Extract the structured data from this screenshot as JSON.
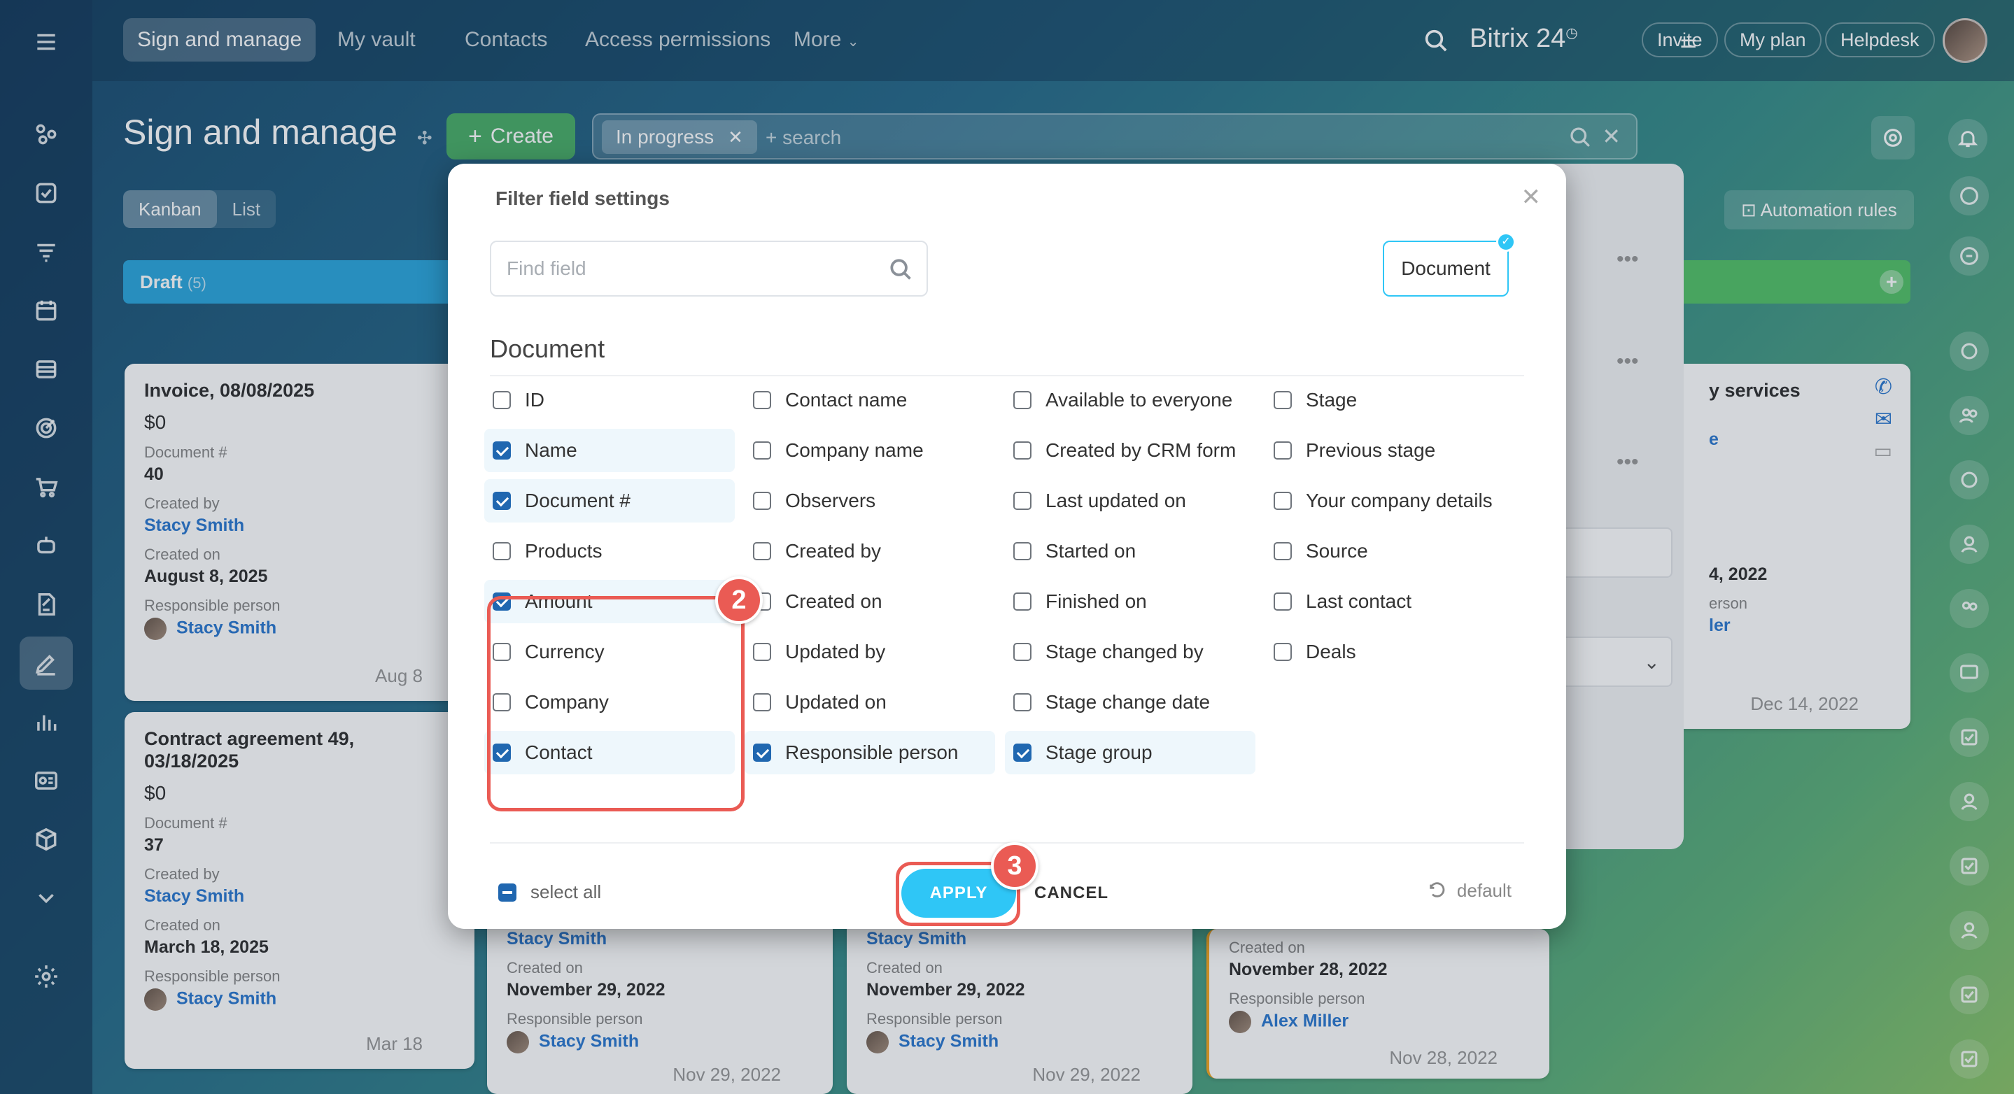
{
  "topbar": {
    "tabs": [
      {
        "label": "Sign and manage"
      },
      {
        "label": "My vault"
      },
      {
        "label": "Contacts"
      },
      {
        "label": "Access permissions"
      },
      {
        "label": "More"
      }
    ],
    "brand": "Bitrix 24",
    "invite_label": "Invite",
    "plan_label": "My plan",
    "helpdesk_label": "Helpdesk"
  },
  "header": {
    "title": "Sign and manage",
    "create_label": "Create",
    "filter_chip": "In progress",
    "search_placeholder": "+ search",
    "views": [
      {
        "label": "Kanban"
      },
      {
        "label": "List"
      }
    ],
    "automation_label": "Automation rules"
  },
  "kanban": {
    "draft_label": "Draft",
    "draft_count": "(5)",
    "cards": [
      {
        "title": "Invoice, 08/08/2025",
        "amount": "$0",
        "doc_label": "Document #",
        "doc_no": "40",
        "created_by_label": "Created by",
        "created_by": "Stacy Smith",
        "created_on_label": "Created on",
        "created_on": "August 8, 2025",
        "resp_label": "Responsible person",
        "resp": "Stacy Smith",
        "date": "Aug 8"
      },
      {
        "title": "Contract agreement 49, 03/18/2025",
        "amount": "$0",
        "doc_label": "Document #",
        "doc_no": "37",
        "created_by_label": "Created by",
        "created_by": "Stacy Smith",
        "created_on_label": "Created on",
        "created_on": "March 18, 2025",
        "resp_label": "Responsible person",
        "resp": "Stacy Smith",
        "date": "Mar 18"
      }
    ],
    "bottom_cards": [
      {
        "created_by": "Stacy Smith",
        "created_on_label": "Created on",
        "created_on": "November 29, 2022",
        "resp_label": "Responsible person",
        "resp": "Stacy Smith",
        "date": "Nov 29, 2022"
      },
      {
        "created_by": "Stacy Smith",
        "created_on_label": "Created on",
        "created_on": "November 29, 2022",
        "resp_label": "Responsible person",
        "resp": "Stacy Smith",
        "date": "Nov 29, 2022"
      },
      {
        "created_on_label": "Created on",
        "created_on": "November 28, 2022",
        "resp_label": "Responsible person",
        "resp": "Alex Miller",
        "date": "Nov 28, 2022"
      }
    ],
    "right_card": {
      "title_fragment": "y services",
      "link_fragment": "e",
      "date_fragment": "4, 2022",
      "label_fragment": "erson",
      "name_fragment": "ler",
      "date": "Dec 14, 2022"
    }
  },
  "modal": {
    "title": "Filter field settings",
    "find_placeholder": "Find field",
    "entity_tab": "Document",
    "section_title": "Document",
    "columns": [
      [
        {
          "label": "ID",
          "checked": false
        },
        {
          "label": "Name",
          "checked": true
        },
        {
          "label": "Document #",
          "checked": true
        },
        {
          "label": "Products",
          "checked": false
        },
        {
          "label": "Amount",
          "checked": true
        },
        {
          "label": "Currency",
          "checked": false
        },
        {
          "label": "Company",
          "checked": false
        },
        {
          "label": "Contact",
          "checked": true
        }
      ],
      [
        {
          "label": "Contact name",
          "checked": false
        },
        {
          "label": "Company name",
          "checked": false
        },
        {
          "label": "Observers",
          "checked": false
        },
        {
          "label": "Created by",
          "checked": false
        },
        {
          "label": "Created on",
          "checked": false
        },
        {
          "label": "Updated by",
          "checked": false
        },
        {
          "label": "Updated on",
          "checked": false
        },
        {
          "label": "Responsible person",
          "checked": true
        }
      ],
      [
        {
          "label": "Available to everyone",
          "checked": false
        },
        {
          "label": "Created by CRM form",
          "checked": false
        },
        {
          "label": "Last updated on",
          "checked": false
        },
        {
          "label": "Started on",
          "checked": false
        },
        {
          "label": "Finished on",
          "checked": false
        },
        {
          "label": "Stage changed by",
          "checked": false
        },
        {
          "label": "Stage change date",
          "checked": false
        },
        {
          "label": "Stage group",
          "checked": true
        }
      ],
      [
        {
          "label": "Stage",
          "checked": false
        },
        {
          "label": "Previous stage",
          "checked": false
        },
        {
          "label": "Your company details",
          "checked": false
        },
        {
          "label": "Source",
          "checked": false
        },
        {
          "label": "Last contact",
          "checked": false
        },
        {
          "label": "Deals",
          "checked": false
        }
      ]
    ],
    "select_all_label": "select all",
    "apply_label": "APPLY",
    "cancel_label": "CANCEL",
    "default_label": "default"
  },
  "annotations": {
    "step_fields": "2",
    "step_apply": "3",
    "color": "#ea5b54"
  },
  "colors": {
    "accent": "#2fc6f6",
    "create_green": "#4caf6a",
    "checkbox_blue": "#2067b0",
    "link_blue": "#2f7ad0"
  }
}
